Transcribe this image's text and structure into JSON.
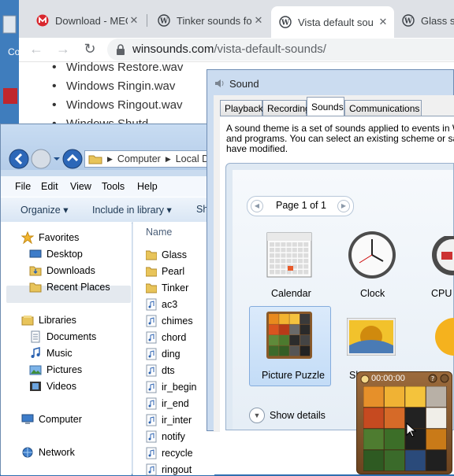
{
  "desktop": {
    "icon_label": "Co"
  },
  "browser": {
    "tabs": [
      {
        "title": "Download - MEG",
        "icon": "mega-icon",
        "active": false
      },
      {
        "title": "Tinker sounds fo",
        "icon": "wordpress-icon",
        "active": false
      },
      {
        "title": "Vista default sou",
        "icon": "wordpress-icon",
        "active": true
      },
      {
        "title": "Glass sou",
        "icon": "wordpress-icon",
        "active": false
      }
    ],
    "tab_close": "✕",
    "url_host": "winsounds.com",
    "url_path": "/vista-default-sounds/",
    "page_list": [
      "Windows Restore.wav",
      "Windows Ringin.wav",
      "Windows Ringout.wav",
      "Windows Shutd"
    ]
  },
  "explorer": {
    "breadcrumb": [
      "Computer",
      "Local D"
    ],
    "menu": [
      "File",
      "Edit",
      "View",
      "Tools",
      "Help"
    ],
    "commands": [
      "Organize ▾",
      "Include in library ▾",
      "Sh"
    ],
    "nav": {
      "favorites": {
        "label": "Favorites",
        "items": [
          "Desktop",
          "Downloads",
          "Recent Places"
        ]
      },
      "libraries": {
        "label": "Libraries",
        "items": [
          "Documents",
          "Music",
          "Pictures",
          "Videos"
        ]
      },
      "computer": "Computer",
      "network": "Network"
    },
    "column_header": "Name",
    "files": [
      {
        "name": "Glass",
        "type": "folder"
      },
      {
        "name": "Pearl",
        "type": "folder"
      },
      {
        "name": "Tinker",
        "type": "folder"
      },
      {
        "name": "ac3",
        "type": "audio"
      },
      {
        "name": "chimes",
        "type": "audio"
      },
      {
        "name": "chord",
        "type": "audio"
      },
      {
        "name": "ding",
        "type": "audio"
      },
      {
        "name": "dts",
        "type": "audio"
      },
      {
        "name": "ir_begin",
        "type": "audio"
      },
      {
        "name": "ir_end",
        "type": "audio"
      },
      {
        "name": "ir_inter",
        "type": "audio"
      },
      {
        "name": "notify",
        "type": "audio"
      },
      {
        "name": "recycle",
        "type": "audio"
      },
      {
        "name": "ringout",
        "type": "audio"
      }
    ]
  },
  "sound_dialog": {
    "title": "Sound",
    "tabs": [
      "Playback",
      "Recording",
      "Sounds",
      "Communications"
    ],
    "active_tab": "Sounds",
    "description_lines": [
      "A sound theme is a set of sounds applied to events in W",
      "and programs.  You can select an existing scheme or sa",
      "have modified."
    ]
  },
  "gadget_gallery": {
    "page_label": "Page 1 of 1",
    "gadgets": [
      "Calendar",
      "Clock",
      "CPU M",
      "Picture Puzzle",
      "Sl",
      ""
    ],
    "selected": "Picture Puzzle",
    "show_details": "Show details"
  },
  "puzzle_gadget": {
    "timer": "00:00:00"
  },
  "colors": {
    "accent": "#1a73e8",
    "explorer_bg": "#c9dbef"
  }
}
